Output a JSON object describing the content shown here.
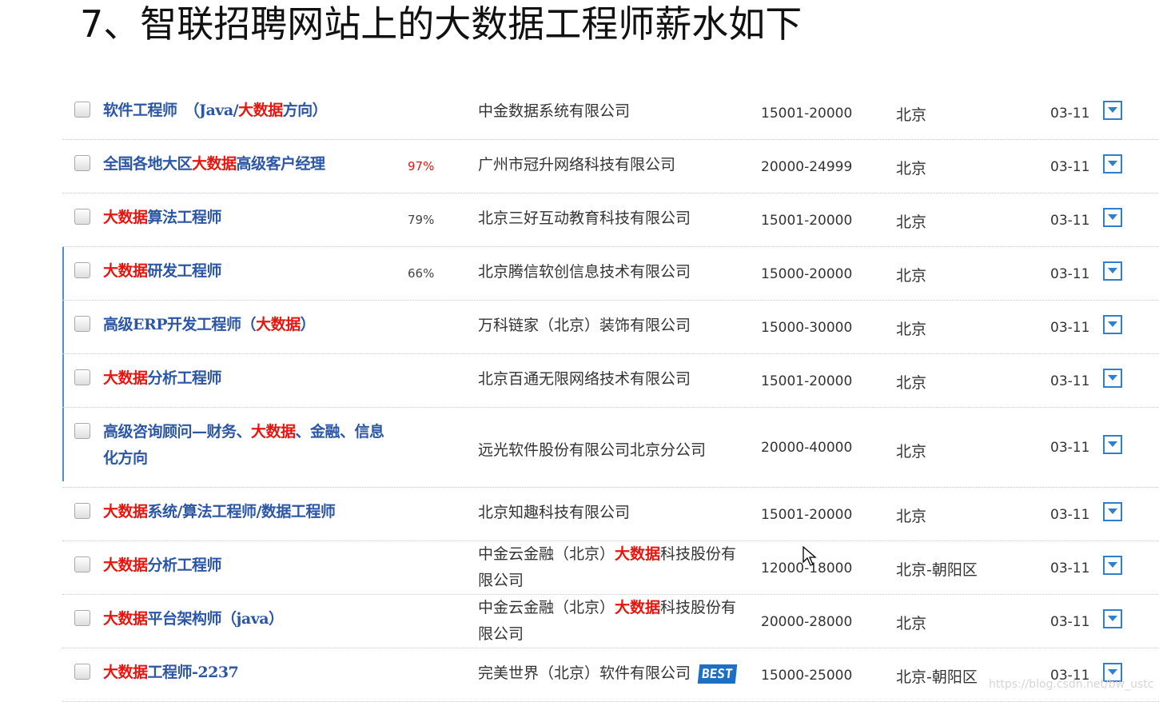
{
  "page_title": "7、智联招聘网站上的大数据工程师薪水如下",
  "colors": {
    "title_blue": "#2c56a6",
    "highlight_red": "#e8150f",
    "accent_blue": "#2f7fd0"
  },
  "icons": {
    "row_checkbox": "checkbox-icon",
    "row_expand": "chevron-down-icon",
    "pointer": "mouse-cursor-icon"
  },
  "jobs": [
    {
      "title": [
        {
          "t": "软件工程师　（Java/"
        },
        {
          "t": "大数据",
          "hl": true
        },
        {
          "t": "方向）"
        }
      ],
      "match": "",
      "company": [
        {
          "t": "中金数据系统有限公司"
        }
      ],
      "salary": "15001-20000",
      "city": "北京",
      "date": "03-11"
    },
    {
      "title": [
        {
          "t": "全国各地大区"
        },
        {
          "t": "大数据",
          "hl": true
        },
        {
          "t": "高级客户经理"
        }
      ],
      "match": "97%",
      "match_red": true,
      "company": [
        {
          "t": "广州市冠升网络科技有限公司"
        }
      ],
      "salary": "20000-24999",
      "city": "北京",
      "date": "03-11"
    },
    {
      "title": [
        {
          "t": "大数据",
          "hl": true
        },
        {
          "t": "算法工程师"
        }
      ],
      "match": "79%",
      "company": [
        {
          "t": "北京三好互动教育科技有限公司"
        }
      ],
      "salary": "15001-20000",
      "city": "北京",
      "date": "03-11"
    },
    {
      "title": [
        {
          "t": "大数据",
          "hl": true
        },
        {
          "t": "研发工程师"
        }
      ],
      "match": "66%",
      "company": [
        {
          "t": "北京腾信软创信息技术有限公司"
        }
      ],
      "salary": "15000-20000",
      "city": "北京",
      "date": "03-11"
    },
    {
      "title": [
        {
          "t": "高级ERP开发工程师（"
        },
        {
          "t": "大数据",
          "hl": true
        },
        {
          "t": "）"
        }
      ],
      "match": "",
      "company": [
        {
          "t": "万科链家（北京）装饰有限公司"
        }
      ],
      "salary": "15000-30000",
      "city": "北京",
      "date": "03-11"
    },
    {
      "title": [
        {
          "t": "大数据",
          "hl": true
        },
        {
          "t": "分析工程师"
        }
      ],
      "match": "",
      "company": [
        {
          "t": "北京百通无限网络技术有限公司"
        }
      ],
      "salary": "15001-20000",
      "city": "北京",
      "date": "03-11"
    },
    {
      "title": [
        {
          "t": "高级咨询顾问—财务、"
        },
        {
          "t": "大数据",
          "hl": true
        },
        {
          "t": "、金融、信息化方向"
        }
      ],
      "match": "",
      "tall": true,
      "company": [
        {
          "t": "远光软件股份有限公司北京分公司"
        }
      ],
      "salary": "20000-40000",
      "city": "北京",
      "date": "03-11"
    },
    {
      "title": [
        {
          "t": "大数据",
          "hl": true
        },
        {
          "t": "系统/算法工程师/数据工程师"
        }
      ],
      "match": "",
      "company": [
        {
          "t": "北京知趣科技有限公司"
        }
      ],
      "salary": "15001-20000",
      "city": "北京",
      "date": "03-11"
    },
    {
      "title": [
        {
          "t": "大数据",
          "hl": true
        },
        {
          "t": "分析工程师"
        }
      ],
      "match": "",
      "company": [
        {
          "t": "中金云金融（北京）"
        },
        {
          "t": "大数据",
          "hl": true
        },
        {
          "t": "科技股份有限公司"
        }
      ],
      "company_two_lines": true,
      "salary": "12000-18000",
      "city": "北京-朝阳区",
      "date": "03-11"
    },
    {
      "title": [
        {
          "t": "大数据",
          "hl": true
        },
        {
          "t": "平台架构师（java）"
        }
      ],
      "match": "",
      "company": [
        {
          "t": "中金云金融（北京）"
        },
        {
          "t": "大数据",
          "hl": true
        },
        {
          "t": "科技股份有限公司"
        }
      ],
      "company_two_lines": true,
      "salary": "20000-28000",
      "city": "北京",
      "date": "03-11"
    },
    {
      "title": [
        {
          "t": "大数据",
          "hl": true
        },
        {
          "t": "工程师-2237"
        }
      ],
      "match": "",
      "company": [
        {
          "t": "完美世界（北京）软件有限公司"
        }
      ],
      "badge": "BEST",
      "salary": "15000-25000",
      "city": "北京-朝阳区",
      "date": "03-11"
    }
  ],
  "watermark": "https://blog.csdn.net/bw_ustc"
}
